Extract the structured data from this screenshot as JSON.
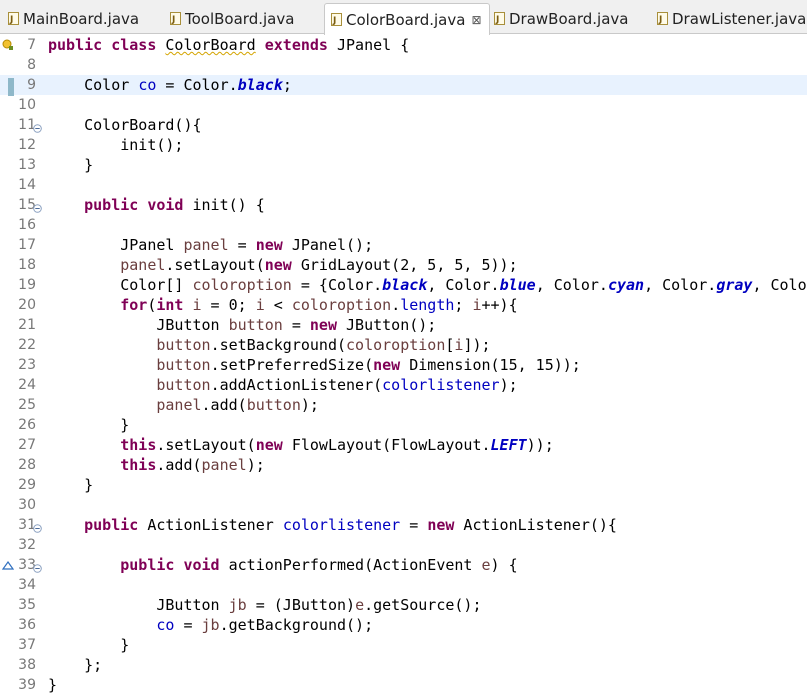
{
  "tabs": [
    {
      "label": "MainBoard.java",
      "active": false
    },
    {
      "label": "ToolBoard.java",
      "active": false
    },
    {
      "label": "ColorBoard.java",
      "active": true,
      "close": "⊠"
    },
    {
      "label": "DrawBoard.java",
      "active": false
    },
    {
      "label": "DrawListener.java",
      "active": false
    }
  ],
  "editor": {
    "current_line": 9,
    "lines": [
      {
        "n": "7",
        "tokens": [
          [
            "kw",
            "public"
          ],
          [
            "t",
            " "
          ],
          [
            "kw",
            "class"
          ],
          [
            "t",
            " "
          ],
          [
            "w",
            "ColorBoard"
          ],
          [
            "t",
            " "
          ],
          [
            "kw",
            "extends"
          ],
          [
            "t",
            " JPanel {"
          ]
        ]
      },
      {
        "n": "8",
        "tokens": []
      },
      {
        "n": "9",
        "tokens": [
          [
            "t",
            "    Color "
          ],
          [
            "fld",
            "co"
          ],
          [
            "t",
            " = Color."
          ],
          [
            "sfld",
            "black"
          ],
          [
            "t",
            ";"
          ]
        ]
      },
      {
        "n": "10",
        "tokens": []
      },
      {
        "n": "11",
        "tokens": [
          [
            "t",
            "    ColorBoard(){"
          ]
        ]
      },
      {
        "n": "12",
        "tokens": [
          [
            "t",
            "        init();"
          ]
        ]
      },
      {
        "n": "13",
        "tokens": [
          [
            "t",
            "    }"
          ]
        ]
      },
      {
        "n": "14",
        "tokens": []
      },
      {
        "n": "15",
        "tokens": [
          [
            "t",
            "    "
          ],
          [
            "kw",
            "public"
          ],
          [
            "t",
            " "
          ],
          [
            "kw",
            "void"
          ],
          [
            "t",
            " init() {"
          ]
        ]
      },
      {
        "n": "16",
        "tokens": []
      },
      {
        "n": "17",
        "tokens": [
          [
            "t",
            "        JPanel "
          ],
          [
            "loc",
            "panel"
          ],
          [
            "t",
            " = "
          ],
          [
            "kw",
            "new"
          ],
          [
            "t",
            " JPanel();"
          ]
        ]
      },
      {
        "n": "18",
        "tokens": [
          [
            "t",
            "        "
          ],
          [
            "loc",
            "panel"
          ],
          [
            "t",
            ".setLayout("
          ],
          [
            "kw",
            "new"
          ],
          [
            "t",
            " GridLayout(2, 5, 5, 5));"
          ]
        ]
      },
      {
        "n": "19",
        "tokens": [
          [
            "t",
            "        Color[] "
          ],
          [
            "loc",
            "coloroption"
          ],
          [
            "t",
            " = {Color."
          ],
          [
            "sfld",
            "black"
          ],
          [
            "t",
            ", Color."
          ],
          [
            "sfld",
            "blue"
          ],
          [
            "t",
            ", Color."
          ],
          [
            "sfld",
            "cyan"
          ],
          [
            "t",
            ", Color."
          ],
          [
            "sfld",
            "gray"
          ],
          [
            "t",
            ", Color"
          ]
        ]
      },
      {
        "n": "20",
        "tokens": [
          [
            "t",
            "        "
          ],
          [
            "kw",
            "for"
          ],
          [
            "t",
            "("
          ],
          [
            "kw",
            "int"
          ],
          [
            "t",
            " "
          ],
          [
            "loc",
            "i"
          ],
          [
            "t",
            " = 0; "
          ],
          [
            "loc",
            "i"
          ],
          [
            "t",
            " < "
          ],
          [
            "loc",
            "coloroption"
          ],
          [
            "t",
            "."
          ],
          [
            "fld",
            "length"
          ],
          [
            "t",
            "; "
          ],
          [
            "loc",
            "i"
          ],
          [
            "t",
            "++){"
          ]
        ]
      },
      {
        "n": "21",
        "tokens": [
          [
            "t",
            "            JButton "
          ],
          [
            "loc",
            "button"
          ],
          [
            "t",
            " = "
          ],
          [
            "kw",
            "new"
          ],
          [
            "t",
            " JButton();"
          ]
        ]
      },
      {
        "n": "22",
        "tokens": [
          [
            "t",
            "            "
          ],
          [
            "loc",
            "button"
          ],
          [
            "t",
            ".setBackground("
          ],
          [
            "loc",
            "coloroption"
          ],
          [
            "t",
            "["
          ],
          [
            "loc",
            "i"
          ],
          [
            "t",
            "]);"
          ]
        ]
      },
      {
        "n": "23",
        "tokens": [
          [
            "t",
            "            "
          ],
          [
            "loc",
            "button"
          ],
          [
            "t",
            ".setPreferredSize("
          ],
          [
            "kw",
            "new"
          ],
          [
            "t",
            " Dimension(15, 15));"
          ]
        ]
      },
      {
        "n": "24",
        "tokens": [
          [
            "t",
            "            "
          ],
          [
            "loc",
            "button"
          ],
          [
            "t",
            ".addActionListener("
          ],
          [
            "fld",
            "colorlistener"
          ],
          [
            "t",
            ");"
          ]
        ]
      },
      {
        "n": "25",
        "tokens": [
          [
            "t",
            "            "
          ],
          [
            "loc",
            "panel"
          ],
          [
            "t",
            ".add("
          ],
          [
            "loc",
            "button"
          ],
          [
            "t",
            ");"
          ]
        ]
      },
      {
        "n": "26",
        "tokens": [
          [
            "t",
            "        }"
          ]
        ]
      },
      {
        "n": "27",
        "tokens": [
          [
            "t",
            "        "
          ],
          [
            "kw",
            "this"
          ],
          [
            "t",
            ".setLayout("
          ],
          [
            "kw",
            "new"
          ],
          [
            "t",
            " FlowLayout(FlowLayout."
          ],
          [
            "sfld",
            "LEFT"
          ],
          [
            "t",
            "));"
          ]
        ]
      },
      {
        "n": "28",
        "tokens": [
          [
            "t",
            "        "
          ],
          [
            "kw",
            "this"
          ],
          [
            "t",
            ".add("
          ],
          [
            "loc",
            "panel"
          ],
          [
            "t",
            ");"
          ]
        ]
      },
      {
        "n": "29",
        "tokens": [
          [
            "t",
            "    }"
          ]
        ]
      },
      {
        "n": "30",
        "tokens": []
      },
      {
        "n": "31",
        "tokens": [
          [
            "t",
            "    "
          ],
          [
            "kw",
            "public"
          ],
          [
            "t",
            " ActionListener "
          ],
          [
            "fld",
            "colorlistener"
          ],
          [
            "t",
            " = "
          ],
          [
            "kw",
            "new"
          ],
          [
            "t",
            " ActionListener(){"
          ]
        ]
      },
      {
        "n": "32",
        "tokens": []
      },
      {
        "n": "33",
        "tokens": [
          [
            "t",
            "        "
          ],
          [
            "kw",
            "public"
          ],
          [
            "t",
            " "
          ],
          [
            "kw",
            "void"
          ],
          [
            "t",
            " actionPerformed(ActionEvent "
          ],
          [
            "loc",
            "e"
          ],
          [
            "t",
            ") {"
          ]
        ]
      },
      {
        "n": "34",
        "tokens": []
      },
      {
        "n": "35",
        "tokens": [
          [
            "t",
            "            JButton "
          ],
          [
            "loc",
            "jb"
          ],
          [
            "t",
            " = (JButton)"
          ],
          [
            "loc",
            "e"
          ],
          [
            "t",
            ".getSource();"
          ]
        ]
      },
      {
        "n": "36",
        "tokens": [
          [
            "t",
            "            "
          ],
          [
            "fld",
            "co"
          ],
          [
            "t",
            " = "
          ],
          [
            "loc",
            "jb"
          ],
          [
            "t",
            ".getBackground();"
          ]
        ]
      },
      {
        "n": "37",
        "tokens": [
          [
            "t",
            "        }"
          ]
        ]
      },
      {
        "n": "38",
        "tokens": [
          [
            "t",
            "    };"
          ]
        ]
      },
      {
        "n": "39",
        "tokens": [
          [
            "t",
            "}"
          ]
        ]
      }
    ]
  },
  "colors": {
    "keyword": "#7f0055",
    "field": "#0000c0",
    "local": "#6a3e3e",
    "line_number": "#787878",
    "current_line": "#e8f2fe"
  }
}
